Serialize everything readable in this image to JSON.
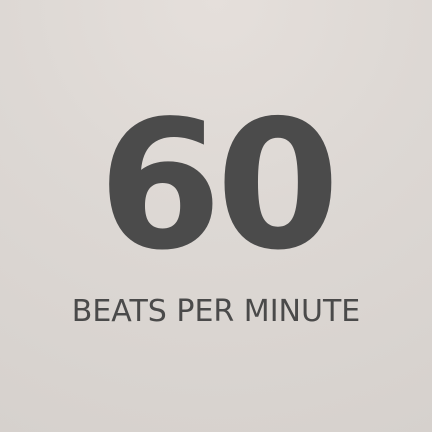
{
  "display": {
    "value": "60",
    "label": "BEATS PER MINUTE"
  },
  "colors": {
    "background": "#ddd8d4",
    "text": "#4b4b4b"
  }
}
